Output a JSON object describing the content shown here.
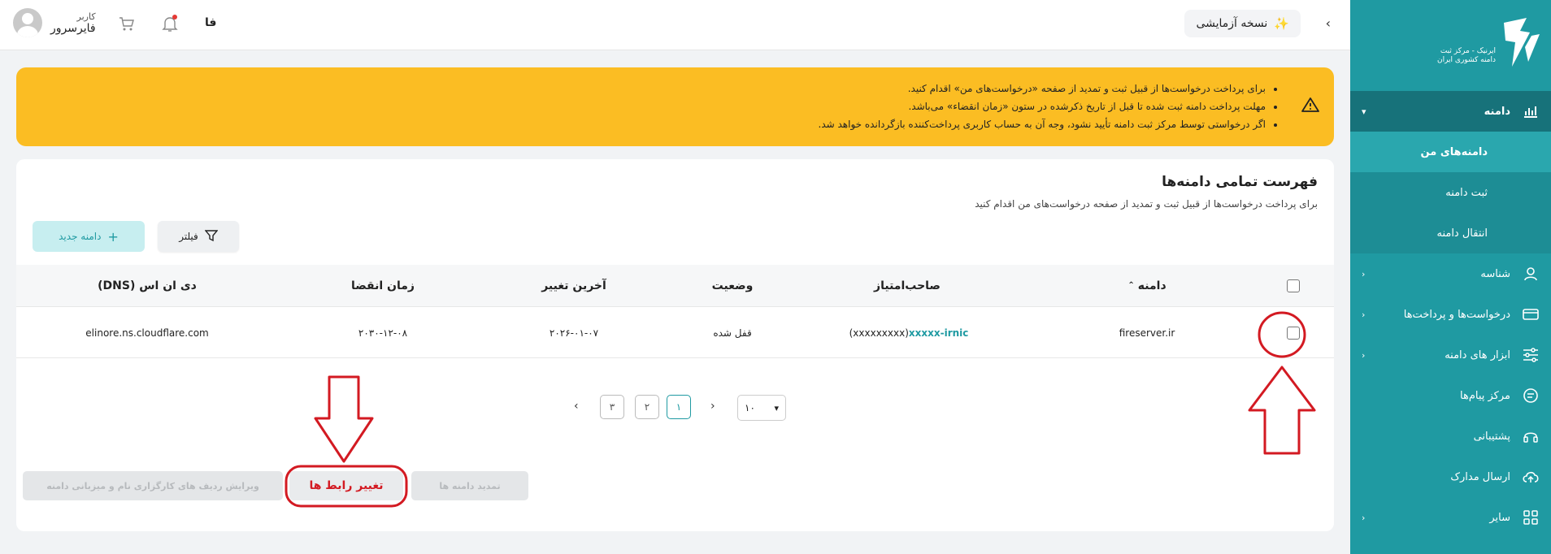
{
  "header": {
    "trial_label": "نسخه آزمایشی",
    "lang": "فا",
    "user_role": "کاربر",
    "user_name": "فایرسرور"
  },
  "sidebar": {
    "logo_line1": "ایرنیک - مرکز ثبت",
    "logo_line2": "دامنه کشوری ایران",
    "domain_menu": "دامنه",
    "sub_items": [
      "دامنه‌های من",
      "ثبت دامنه",
      "انتقال دامنه"
    ],
    "items": [
      "شناسه",
      "درخواست‌ها و پرداخت‌ها",
      "ابزار های دامنه",
      "مرکز پیام‌ها",
      "پشتیبانی",
      "ارسال مدارک",
      "سایر"
    ]
  },
  "alert": {
    "lines": [
      "برای پرداخت درخواست‌ها از قبیل ثبت و تمدید از صفحه «درخواست‌های من» اقدام کنید.",
      "مهلت پرداخت دامنه ثبت شده تا قبل از تاریخ ذکرشده در ستون «زمان انقضاء» می‌باشد.",
      "اگر درخواستی توسط مرکز ثبت دامنه تأیید نشود، وجه آن به حساب کاربری پرداخت‌کننده بازگردانده خواهد شد."
    ]
  },
  "card": {
    "title": "فهرست تمامی دامنه‌ها",
    "subtitle": "برای پرداخت درخواست‌ها از قبیل ثبت و تمدید از صفحه درخواست‌های من اقدام کنید",
    "filter_label": "فیلتر",
    "new_domain_label": "دامنه جدید"
  },
  "table": {
    "headers": {
      "domain": "دامنه",
      "owner": "صاحب‌امتیاز",
      "status": "وضعیت",
      "last_change": "آخرین تغییر",
      "expiry": "زمان انقضا",
      "dns": "دی ان اس (DNS)"
    },
    "rows": [
      {
        "domain": "fireserver.ir",
        "owner_handle": "xxxxx-irnic",
        "owner_paren": "(xxxxxxxxx)",
        "status": "قفل شده",
        "last_change": "۲۰۲۶-۰۱-۰۷",
        "expiry": "۲۰۳۰-۱۲-۰۸",
        "dns": "elinore.ns.cloudflare.com"
      }
    ]
  },
  "pagination": {
    "pages": [
      "۱",
      "۲",
      "۳"
    ],
    "active_page": "۱",
    "page_size": "۱۰"
  },
  "actions": {
    "renew": "تمدید دامنه ها",
    "change_links": "تغییر رابط ها",
    "edit_records": "ویرایش ردیف های کارگزاری نام و میزبانی دامنه"
  },
  "colors": {
    "brand": "#1f9aa2",
    "alert_bg": "#fbbd23",
    "annotation": "#d31a22"
  }
}
